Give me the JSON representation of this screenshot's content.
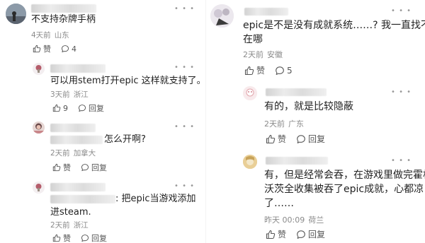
{
  "left_column": [
    {
      "text_lines": [
        "不支持杂牌手柄"
      ],
      "time": "4天前",
      "location": "山东",
      "like_label": "赞",
      "reply_count": "4"
    },
    {
      "text_lines": [
        "可以用stem打开epic 这样就支持了。"
      ],
      "time": "3天前",
      "location": "浙江",
      "like_count": "9",
      "reply_label": "回复"
    },
    {
      "text_lines": [
        "怎么开啊?"
      ],
      "time": "2天前",
      "location": "加拿大",
      "like_label": "赞",
      "reply_label": "回复"
    },
    {
      "text_lines": [
        ": 把epic当游戏添加",
        "进steam."
      ],
      "time": "2天前",
      "location": "浙江",
      "like_label": "赞",
      "reply_label": "回复"
    }
  ],
  "right_column": [
    {
      "text_lines": [
        "epic是不是没有成就系统……? 我一直找不到",
        "在哪"
      ],
      "time": "2天前",
      "location": "安徽",
      "like_label": "赞",
      "reply_count": "5"
    },
    {
      "text_lines": [
        "有的，就是比较隐蔽"
      ],
      "time": "2天前",
      "location": "广东",
      "like_label": "赞",
      "reply_label": "回复"
    },
    {
      "text_lines": [
        "有，但是经常会吞，在游戏里做完霍格",
        "沃茨全收集被吞了epic成就，心都凉",
        "了……"
      ],
      "time": "昨天 00:09",
      "location": "荷兰",
      "like_label": "赞",
      "reply_label": "回复"
    }
  ],
  "more_glyph": "• • •",
  "colors": {
    "text": "#222222",
    "meta": "#8a8a8a",
    "icon": "#555555"
  }
}
